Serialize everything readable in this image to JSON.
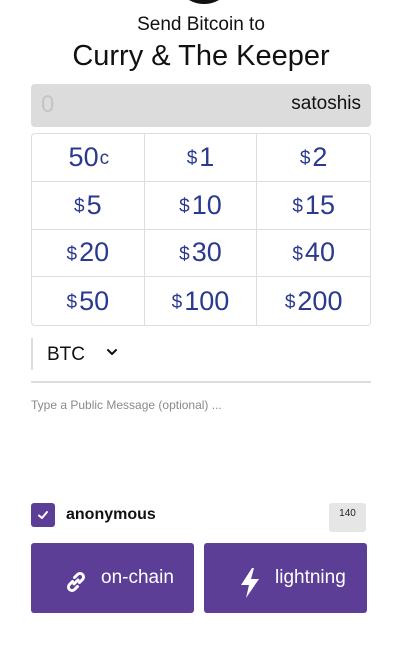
{
  "header": {
    "title": "Send Bitcoin to",
    "recipient": "Curry & The Keeper"
  },
  "amount": {
    "placeholder": "0",
    "unit": "satoshis"
  },
  "presets": [
    {
      "prefix": "",
      "value": "50",
      "suffix": "c"
    },
    {
      "prefix": "$",
      "value": "1",
      "suffix": ""
    },
    {
      "prefix": "$",
      "value": "2",
      "suffix": ""
    },
    {
      "prefix": "$",
      "value": "5",
      "suffix": ""
    },
    {
      "prefix": "$",
      "value": "10",
      "suffix": ""
    },
    {
      "prefix": "$",
      "value": "15",
      "suffix": ""
    },
    {
      "prefix": "$",
      "value": "20",
      "suffix": ""
    },
    {
      "prefix": "$",
      "value": "30",
      "suffix": ""
    },
    {
      "prefix": "$",
      "value": "40",
      "suffix": ""
    },
    {
      "prefix": "$",
      "value": "50",
      "suffix": ""
    },
    {
      "prefix": "$",
      "value": "100",
      "suffix": ""
    },
    {
      "prefix": "$",
      "value": "200",
      "suffix": ""
    }
  ],
  "currency": {
    "selected": "BTC",
    "icon": "chevron-down-icon"
  },
  "message": {
    "placeholder": "Type a Public Message (optional) ..."
  },
  "anonymous": {
    "label": "anonymous",
    "checked": true
  },
  "char_count": "140",
  "buttons": {
    "onchain": {
      "label": "on-chain",
      "icon": "link-icon"
    },
    "lightning": {
      "label": "lightning",
      "icon": "lightning-bolt-icon"
    }
  },
  "colors": {
    "accent": "#5d3e96",
    "preset_text": "#2b3a8f",
    "input_bg": "#dcdcdc"
  }
}
